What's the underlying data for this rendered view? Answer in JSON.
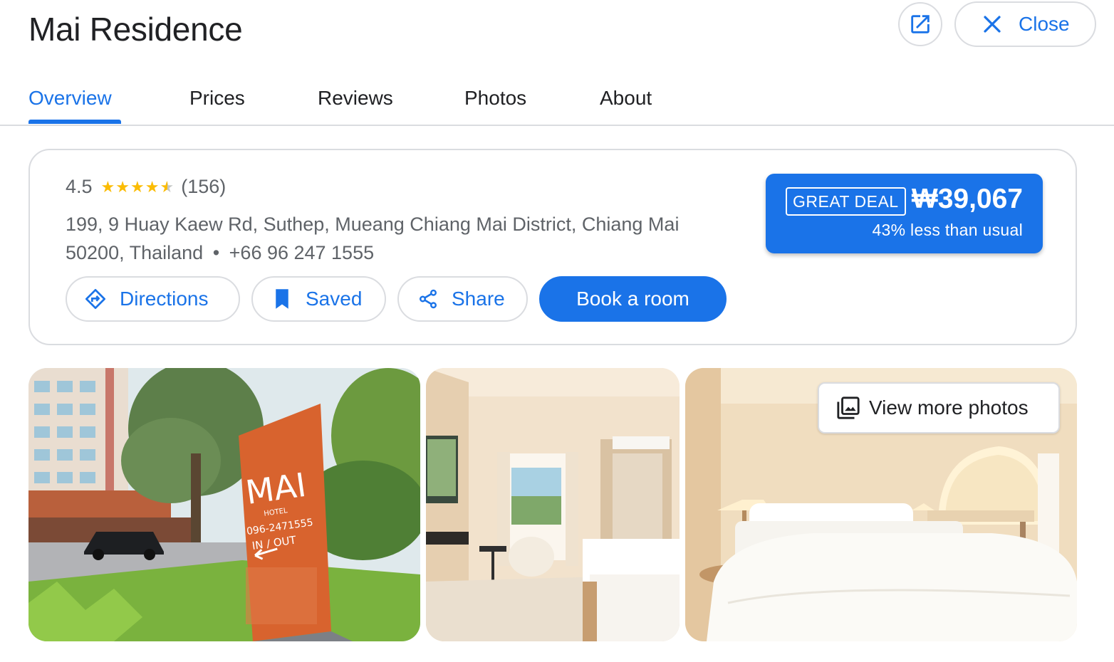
{
  "header": {
    "title": "Mai Residence",
    "open_icon": "open-in-new-icon",
    "close_icon": "close-x-icon",
    "close_label": "Close"
  },
  "tabs": [
    {
      "label": "Overview",
      "active": true
    },
    {
      "label": "Prices",
      "active": false
    },
    {
      "label": "Reviews",
      "active": false
    },
    {
      "label": "Photos",
      "active": false
    },
    {
      "label": "About",
      "active": false
    }
  ],
  "info": {
    "rating": "4.5",
    "stars": 4.5,
    "review_count": "(156)",
    "address_line1": "199, 9 Huay Kaew Rd, Suthep, Mueang Chiang Mai District, Chiang Mai",
    "address_line2": "50200, Thailand",
    "separator": "•",
    "phone": "+66 96 247 1555"
  },
  "actions": {
    "directions": "Directions",
    "saved": "Saved",
    "share": "Share",
    "book": "Book a room"
  },
  "deal": {
    "badge": "GREAT DEAL",
    "price": "₩39,067",
    "subtext": "43% less than usual"
  },
  "photos": {
    "view_more_label": "View more photos",
    "images": [
      "hotel-exterior-sign",
      "twin-bedroom",
      "double-bedroom"
    ],
    "sign": {
      "brand": "MAI",
      "sub": "HOTEL",
      "phone": "096-2471555",
      "inout": "IN / OUT"
    }
  },
  "colors": {
    "accent": "#1a73e8",
    "border": "#dadce0",
    "text": "#202124",
    "muted": "#5f6368",
    "star": "#fbbc04"
  }
}
